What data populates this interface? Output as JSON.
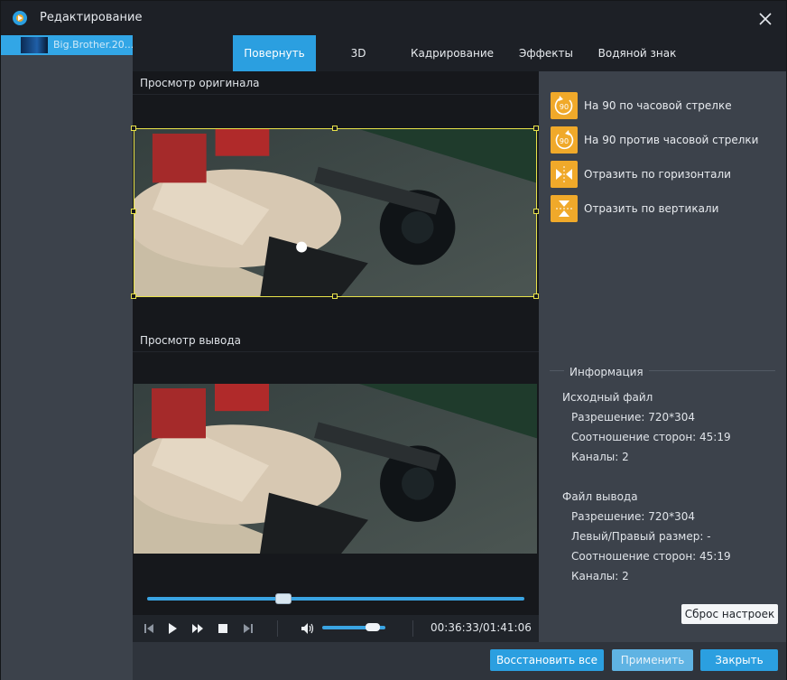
{
  "window": {
    "title": "Редактирование",
    "close_icon": "close-icon"
  },
  "filelist": {
    "items": [
      {
        "name": "Big.Brother.20..."
      }
    ]
  },
  "tabs": [
    {
      "label": "Повернуть",
      "active": true
    },
    {
      "label": "3D",
      "active": false
    },
    {
      "label": "Кадрирование",
      "active": false
    },
    {
      "label": "Эффекты",
      "active": false
    },
    {
      "label": "Водяной знак",
      "active": false
    }
  ],
  "preview": {
    "original_label": "Просмотр оригинала",
    "output_label": "Просмотр вывода"
  },
  "playback": {
    "current_time": "00:36:33",
    "total_time": "01:41:06",
    "timecode": "00:36:33/01:41:06",
    "progress_fraction": 0.361,
    "volume_fraction": 0.8
  },
  "rotate": {
    "cw_label": "На 90 по часовой стрелке",
    "ccw_label": "На 90 против часовой стрелки",
    "flip_h_label": "Отразить по горизонтали",
    "flip_v_label": "Отразить по вертикали",
    "icon_badge": "90"
  },
  "info": {
    "title": "Информация",
    "source": {
      "heading": "Исходный файл",
      "resolution": "Разрешение: 720*304",
      "aspect": "Соотношение сторон: 45:19",
      "channels": "Каналы: 2"
    },
    "output": {
      "heading": "Файл вывода",
      "resolution": "Разрешение: 720*304",
      "lr_size": "Левый/Правый размер: -",
      "aspect": "Соотношение сторон: 45:19",
      "channels": "Каналы: 2"
    }
  },
  "buttons": {
    "reset": "Сброс настроек",
    "restore_all": "Восстановить все",
    "apply": "Применить",
    "close": "Закрыть"
  },
  "colors": {
    "accent": "#2b9fe0",
    "icon_orange": "#f0a92a",
    "crop_border": "#e8e24a"
  }
}
